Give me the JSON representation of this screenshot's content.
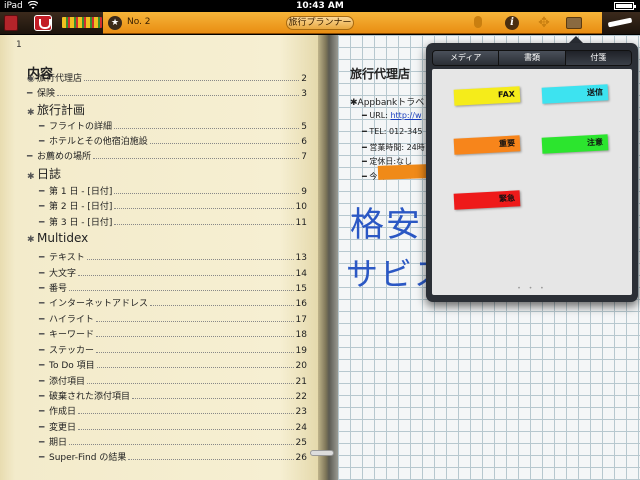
{
  "status_bar": {
    "carrier": "iPad",
    "time": "10:43 AM",
    "battery_percent": 90
  },
  "toolbar": {
    "page_label": "No. 2",
    "notebook_title": "旅行プランナー",
    "star_symbol": "★",
    "info_symbol": "i",
    "move_symbol": "✥"
  },
  "left_page": {
    "page_number": "1",
    "title": "内容",
    "toc": [
      {
        "mark": "◉",
        "text": "旅行代理店",
        "page": "2",
        "level": "lvl2"
      },
      {
        "mark": "━",
        "text": "保険",
        "page": "3",
        "level": "lvl2"
      },
      {
        "mark": "✱",
        "text": "旅行計画",
        "page": "",
        "level": "lvl1"
      },
      {
        "mark": "━",
        "text": "フライトの詳細",
        "page": "5",
        "level": "lvl3"
      },
      {
        "mark": "━",
        "text": "ホテルとその他宿泊施設",
        "page": "6",
        "level": "lvl3"
      },
      {
        "mark": "━",
        "text": "お薦めの場所",
        "page": "7",
        "level": "lvl2"
      },
      {
        "mark": "✱",
        "text": "日誌",
        "page": "",
        "level": "lvl1"
      },
      {
        "mark": "━",
        "text": "第 1 日 - [日付]",
        "page": "9",
        "level": "lvl3"
      },
      {
        "mark": "━",
        "text": "第 2 日 - [日付]",
        "page": "10",
        "level": "lvl3"
      },
      {
        "mark": "━",
        "text": "第 3 日 - [日付]",
        "page": "11",
        "level": "lvl3"
      },
      {
        "mark": "✱",
        "text": "Multidex",
        "page": "",
        "level": "lvl1"
      },
      {
        "mark": "━",
        "text": "テキスト",
        "page": "13",
        "level": "lvl3"
      },
      {
        "mark": "━",
        "text": "大文字",
        "page": "14",
        "level": "lvl3"
      },
      {
        "mark": "━",
        "text": "番号",
        "page": "15",
        "level": "lvl3"
      },
      {
        "mark": "━",
        "text": "インターネットアドレス",
        "page": "16",
        "level": "lvl3"
      },
      {
        "mark": "━",
        "text": "ハイライト",
        "page": "17",
        "level": "lvl3"
      },
      {
        "mark": "━",
        "text": "キーワード",
        "page": "18",
        "level": "lvl3"
      },
      {
        "mark": "━",
        "text": "ステッカー",
        "page": "19",
        "level": "lvl3"
      },
      {
        "mark": "━",
        "text": "To Do 項目",
        "page": "20",
        "level": "lvl3"
      },
      {
        "mark": "━",
        "text": "添付項目",
        "page": "21",
        "level": "lvl3"
      },
      {
        "mark": "━",
        "text": "破棄された添付項目",
        "page": "22",
        "level": "lvl3"
      },
      {
        "mark": "━",
        "text": "作成日",
        "page": "23",
        "level": "lvl3"
      },
      {
        "mark": "━",
        "text": "変更日",
        "page": "24",
        "level": "lvl3"
      },
      {
        "mark": "━",
        "text": "期日",
        "page": "25",
        "level": "lvl3"
      },
      {
        "mark": "━",
        "text": "Super-Find の結果",
        "page": "26",
        "level": "lvl3"
      }
    ]
  },
  "right_page": {
    "title": "旅行代理店",
    "company": "✱Appbankトラベ",
    "lines": [
      {
        "text": "URL: ",
        "link": "http://w"
      },
      {
        "text": "TEL: 012-345",
        "link": ""
      },
      {
        "text": "営業時間: 24時",
        "link": ""
      },
      {
        "text": "定休日:なし",
        "link": ""
      },
      {
        "text": "今日",
        "link": ""
      }
    ],
    "handwriting_1": "格安",
    "handwriting_2": "サビス"
  },
  "popover": {
    "tabs": [
      {
        "label": "メディア",
        "active": false
      },
      {
        "label": "書類",
        "active": false
      },
      {
        "label": "付箋",
        "active": true
      }
    ],
    "tags": [
      {
        "label": "FAX",
        "color": "#f5ec1a"
      },
      {
        "label": "送信",
        "color": "#3de3f0"
      },
      {
        "label": "重要",
        "color": "#f7851b"
      },
      {
        "label": "注意",
        "color": "#2ce52e"
      },
      {
        "label": "緊急",
        "color": "#ee1a1a"
      }
    ],
    "pager": "• • •"
  }
}
